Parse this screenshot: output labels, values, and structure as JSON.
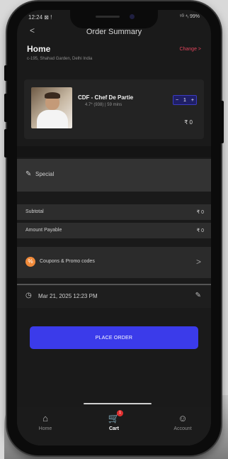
{
  "status_bar": {
    "time": "12:24 ⊠ !",
    "right": "⁵ᴳ ⁴ᵢ 99%"
  },
  "header": {
    "back_glyph": "<",
    "title": "Order Summary"
  },
  "address": {
    "label": "Home",
    "line": "c-195, Shahad Garden, Delhi India",
    "change_label": "Change >"
  },
  "item": {
    "name": "CDF - Chef De Partie",
    "meta": "4.7* (938) | 59 mins",
    "quantity": "1",
    "price": "₹ 0"
  },
  "special": {
    "icon": "✎",
    "label": "Special"
  },
  "totals": {
    "subtotal_label": "Subtotal",
    "subtotal_value": "₹ 0",
    "payable_label": "Amount Payable",
    "payable_value": "₹ 0"
  },
  "coupon": {
    "label": "Coupons & Promo codes",
    "chevron": ">"
  },
  "schedule": {
    "datetime": "Mar 21, 2025 12:23 PM"
  },
  "cta": {
    "label": "PLACE ORDER"
  },
  "tabs": [
    {
      "label": "Home",
      "icon": "home-icon"
    },
    {
      "label": "Cart",
      "icon": "cart-icon",
      "badge": "1"
    },
    {
      "label": "Account",
      "icon": "account-icon"
    }
  ],
  "colors": {
    "accent": "#3b3bea",
    "link": "#e0445c",
    "coupon": "#f08a3a",
    "badge": "#e23030",
    "background": "#1a1a1a"
  }
}
